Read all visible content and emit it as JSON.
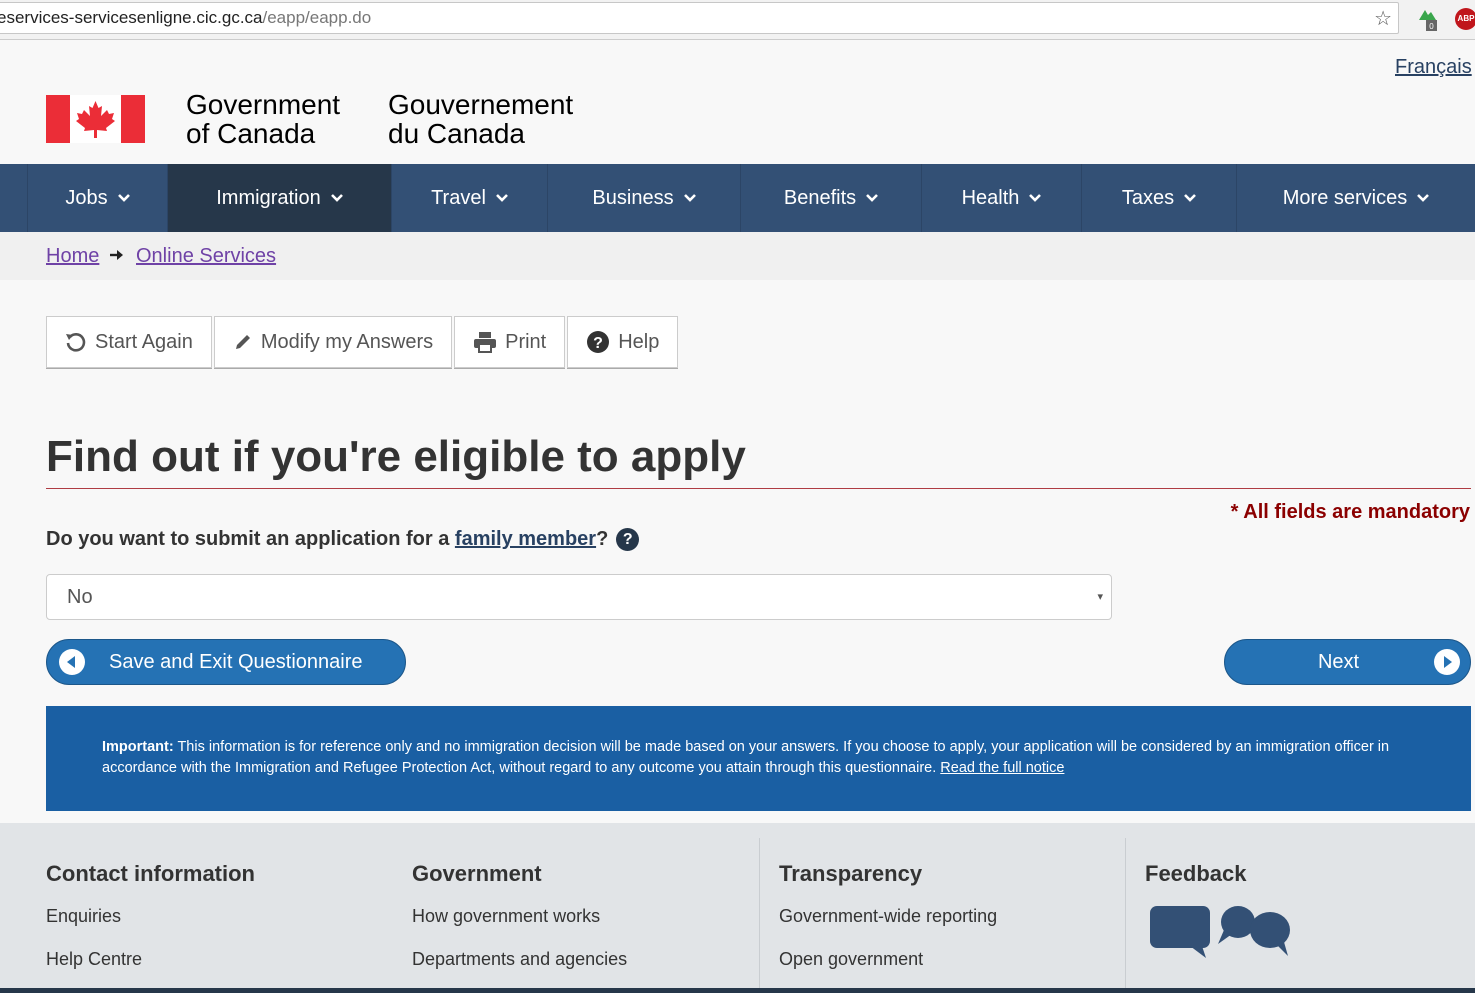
{
  "browser": {
    "url_host": "eservices-servicesenligne.cic.gc.ca",
    "url_path": "/eapp/eapp.do",
    "star_icon": "star-icon",
    "ext1_badge": "0",
    "ext2_label": "ABP"
  },
  "header": {
    "language_link": "Français",
    "wordmark_en_line1": "Government",
    "wordmark_en_line2": "of Canada",
    "wordmark_fr_line1": "Gouvernement",
    "wordmark_fr_line2": "du Canada"
  },
  "nav": {
    "items": [
      {
        "label": "Jobs"
      },
      {
        "label": "Immigration"
      },
      {
        "label": "Travel"
      },
      {
        "label": "Business"
      },
      {
        "label": "Benefits"
      },
      {
        "label": "Health"
      },
      {
        "label": "Taxes"
      },
      {
        "label": "More services"
      }
    ]
  },
  "breadcrumb": {
    "home": "Home",
    "online_services": "Online Services"
  },
  "toolbar": {
    "start_again": "Start Again",
    "modify": "Modify my Answers",
    "print": "Print",
    "help": "Help"
  },
  "main": {
    "title": "Find out if you're eligible to apply",
    "mandatory_note": "* All fields are mandatory",
    "question_prefix": "Do you want to submit an application for a ",
    "question_link": "family member",
    "question_suffix": "?",
    "help_glyph": "?",
    "select_value": "No",
    "select_caret": "▾",
    "save_exit": "Save and Exit Questionnaire",
    "next": "Next"
  },
  "notice": {
    "label": "Important:",
    "text": " This information is for reference only and no immigration decision will be made based on your answers. If you choose to apply, your application will be considered by an immigration officer in accordance with the Immigration and Refugee Protection Act, without regard to any outcome you attain through this questionnaire. ",
    "link": "Read the full notice"
  },
  "footer": {
    "contact": {
      "heading": "Contact information",
      "links": [
        "Enquiries",
        "Help Centre"
      ]
    },
    "government": {
      "heading": "Government",
      "links": [
        "How government works",
        "Departments and agencies"
      ]
    },
    "transparency": {
      "heading": "Transparency",
      "links": [
        "Government-wide reporting",
        "Open government"
      ]
    },
    "feedback": {
      "heading": "Feedback"
    }
  },
  "colors": {
    "nav_bg": "#335075",
    "nav_active": "#26374a",
    "button_blue": "#2572b4",
    "notice_blue": "#1a5fa3",
    "rule_red": "#af3c43",
    "flag_red": "#eb2d37"
  }
}
